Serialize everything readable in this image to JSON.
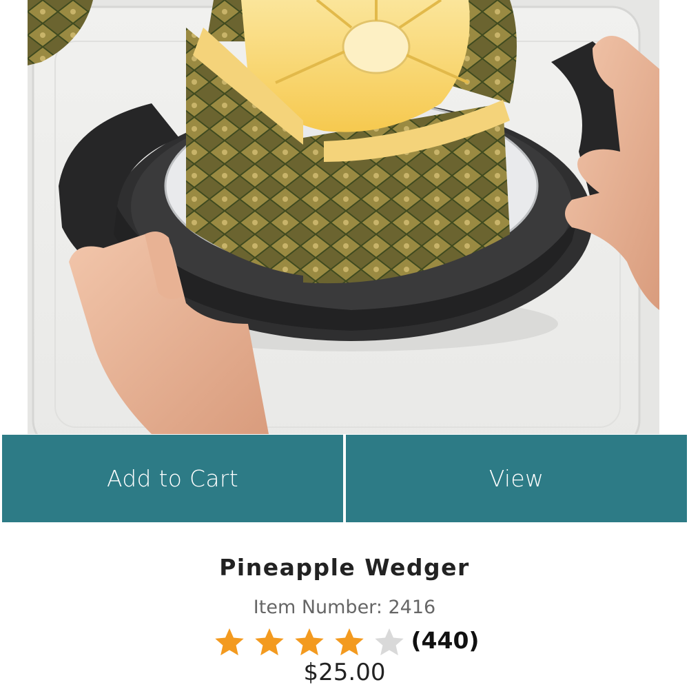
{
  "product": {
    "image_alt": "Pineapple wedger slicing a pineapple",
    "name": "Pineapple Wedger",
    "item_number_label": "Item Number: 2416",
    "rating": 4,
    "rating_max": 5,
    "review_count": "(440)",
    "price": "$25.00"
  },
  "actions": {
    "add_to_cart_label": "Add to Cart",
    "view_label": "View"
  },
  "colors": {
    "button_bg": "#2d7b86",
    "star_filled": "#f39a1f",
    "star_empty": "#d9d9d9"
  }
}
